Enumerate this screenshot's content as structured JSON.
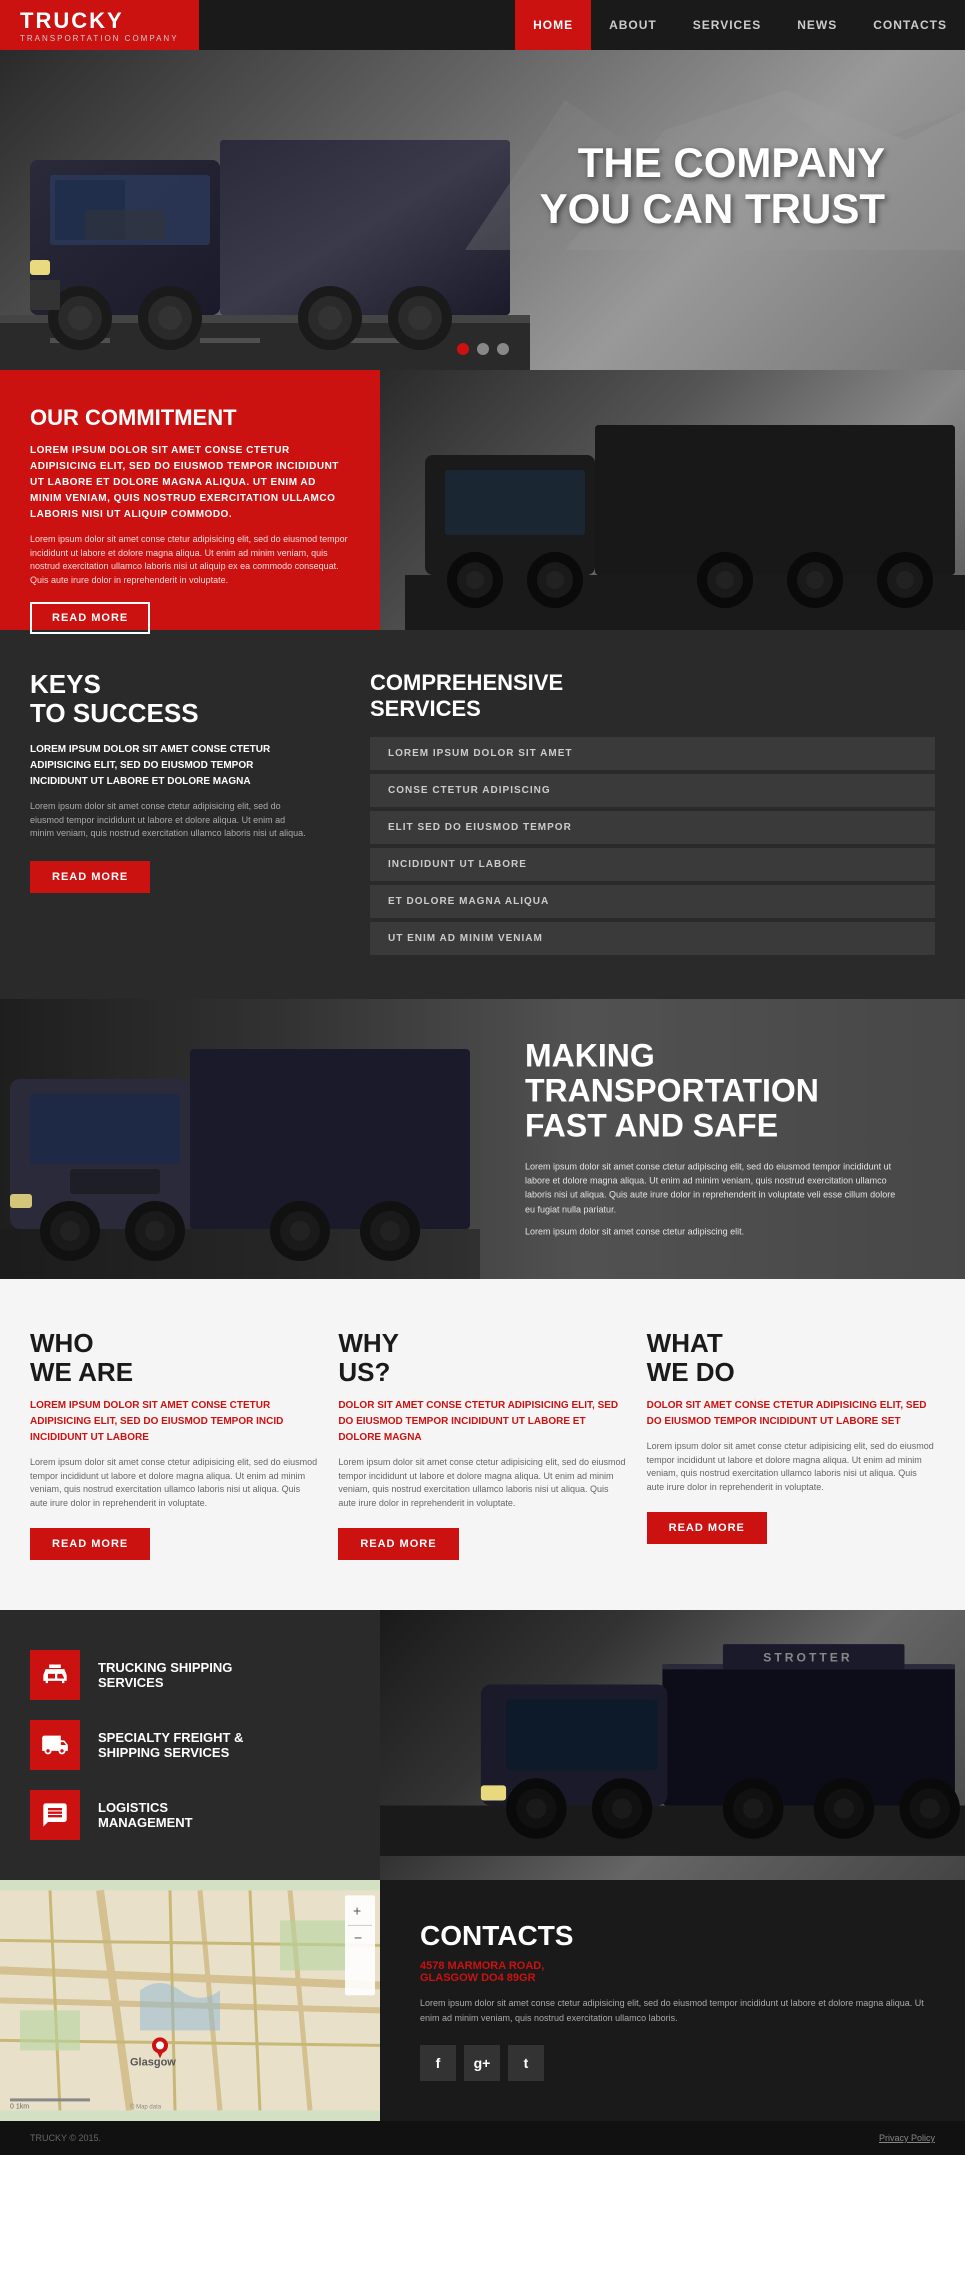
{
  "nav": {
    "logo": "TRUCKY",
    "logo_sub": "TRANSPORTATION COMPANY",
    "links": [
      {
        "label": "HOME",
        "active": true
      },
      {
        "label": "ABOUT",
        "active": false
      },
      {
        "label": "SERVICES",
        "active": false
      },
      {
        "label": "NEWS",
        "active": false
      },
      {
        "label": "CONTACTS",
        "active": false
      }
    ]
  },
  "hero": {
    "title_line1": "THE COMPANY",
    "title_line2": "YOU CAN TRUST"
  },
  "commitment": {
    "title": "OUR COMMITMENT",
    "bold_text": "LOREM IPSUM DOLOR SIT AMET CONSE CTETUR ADIPISICING ELIT, SED DO EIUSMOD TEMPOR INCIDIDUNT UT LABORE ET DOLORE MAGNA ALIQUA. UT ENIM AD MINIM VENIAM, QUIS NOSTRUD EXERCITATION ULLAMCO LABORIS NISI UT ALIQUIP COMMODO.",
    "normal_text": "Lorem ipsum dolor sit amet conse ctetur adipisicing elit, sed do eiusmod tempor incididunt ut labore et dolore magna aliqua. Ut enim ad minim veniam, quis nostrud exercitation ullamco laboris nisi ut aliquip ex ea commodo consequat. Quis aute irure dolor in reprehenderit in voluptate.",
    "button": "READ MORE"
  },
  "keys": {
    "title_line1": "KEYS",
    "title_line2": "TO SUCCESS",
    "bold_text": "LOREM IPSUM DOLOR SIT AMET CONSE CTETUR ADIPISICING ELIT, SED DO EIUSMOD TEMPOR INCIDIDUNT UT LABORE ET DOLORE MAGNA",
    "normal_text": "Lorem ipsum dolor sit amet conse ctetur adipisicing elit, sed do eiusmod tempor incididunt ut labore et dolore aliqua. Ut enim ad minim veniam, quis nostrud exercitation ullamco laboris nisi ut aliqua.",
    "button": "READ MORE"
  },
  "services_list": {
    "title": "COMPREHENSIVE\nSERVICES",
    "items": [
      "LOREM IPSUM DOLOR SIT AMET",
      "CONSE CTETUR ADIPISCING",
      "ELIT SED DO EIUSMOD TEMPOR",
      "INCIDIDUNT UT LABORE",
      "ET DOLORE MAGNA ALIQUA",
      "UT ENIM AD MINIM VENIAM"
    ]
  },
  "transport_banner": {
    "title_line1": "MAKING",
    "title_line2": "TRANSPORTATION",
    "title_line3": "FAST AND SAFE",
    "text1": "Lorem ipsum dolor sit amet conse ctetur adipiscing elit, sed do eiusmod tempor incididunt ut labore et dolore magna aliqua. Ut enim ad minim veniam, quis nostrud exercitation ullamco laboris nisi ut aliqua. Quis aute irure dolor in reprehenderit in voluptate veli esse cillum dolore eu fugiat nulla pariatur.",
    "text2": "Lorem ipsum dolor sit amet conse ctetur adipiscing elit."
  },
  "who": {
    "title_line1": "WHO",
    "title_line2": "WE ARE",
    "bold": "LOREM IPSUM DOLOR SIT AMET CONSE CTETUR ADIPISICING ELIT, SED DO EIUSMOD TEMPOR INCID INCIDIDUNT UT LABORE",
    "text": "Lorem ipsum dolor sit amet conse ctetur adipisicing elit, sed do eiusmod tempor incididunt ut labore et dolore magna aliqua. Ut enim ad minim veniam, quis nostrud exercitation ullamco laboris nisi ut aliqua. Quis aute irure dolor in reprehenderit in voluptate.",
    "button": "READ MORE"
  },
  "why": {
    "title_line1": "WHY",
    "title_line2": "US?",
    "bold": "DOLOR SIT AMET CONSE CTETUR ADIPISICING ELIT, SED DO EIUSMOD TEMPOR INCIDIDUNT UT LABORE ET DOLORE MAGNA",
    "text": "Lorem ipsum dolor sit amet conse ctetur adipisicing elit, sed do eiusmod tempor incididunt ut labore et dolore magna aliqua. Ut enim ad minim veniam, quis nostrud exercitation ullamco laboris nisi ut aliqua. Quis aute irure dolor in reprehenderit in voluptate.",
    "button": "READ MORE"
  },
  "what": {
    "title_line1": "WHAT",
    "title_line2": "WE DO",
    "bold": "DOLOR SIT AMET CONSE CTETUR ADIPISICING ELIT, SED DO EIUSMOD TEMPOR INCIDIDUNT UT LABORE SET",
    "text": "Lorem ipsum dolor sit amet conse ctetur adipisicing elit, sed do eiusmod tempor incididunt ut labore et dolore magna aliqua. Ut enim ad minim veniam, quis nostrud exercitation ullamco laboris nisi ut aliqua. Quis aute irure dolor in reprehenderit in voluptate.",
    "button": "READ MORE"
  },
  "services_icons": {
    "items": [
      {
        "title": "TRUCKING SHIPPING\nSERVICES",
        "icon": "box"
      },
      {
        "title": "SPECIALTY FREIGHT &\nSHIPPING SERVICES",
        "icon": "truck"
      },
      {
        "title": "LOGISTICS\nMANAGEMENT",
        "icon": "chat"
      }
    ]
  },
  "contacts": {
    "title": "CONTACTS",
    "address_line1": "4578 MARMORA ROAD,",
    "address_line2": "GLASGOW DO4 89GR",
    "text": "Lorem ipsum dolor sit amet conse ctetur adipisicing elit, sed do eiusmod tempor incididunt ut labore et dolore magna aliqua. Ut enim ad minim veniam, quis nostrud exercitation ullamco laboris.",
    "map_city": "Glasgow",
    "social": [
      "f",
      "g+",
      "t"
    ]
  },
  "footer": {
    "copyright": "TRUCKY © 2015.",
    "privacy": "Privacy Policy"
  },
  "colors": {
    "red": "#cc1111",
    "dark": "#1a1a1a",
    "gray": "#2a2a2a"
  }
}
